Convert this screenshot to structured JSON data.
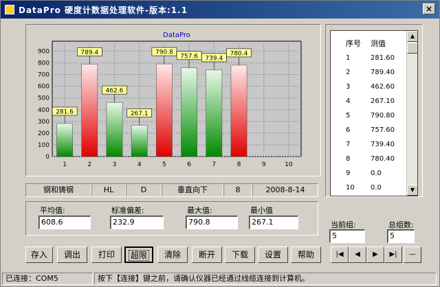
{
  "window": {
    "title": "DataPro 硬度计数据处理软件-版本:1.1",
    "close_label": "×"
  },
  "chart_data": {
    "type": "bar",
    "title": "DataPro",
    "categories": [
      "1",
      "2",
      "3",
      "4",
      "5",
      "6",
      "7",
      "8",
      "9",
      "10"
    ],
    "values": [
      281.6,
      789.4,
      462.6,
      267.1,
      790.8,
      757.6,
      739.4,
      780.4,
      null,
      null
    ],
    "value_labels": [
      "281.6",
      "789.4",
      "462.6",
      "267.1",
      "790.8",
      "757.6",
      "739.4",
      "780.4"
    ],
    "bar_colors": [
      "green",
      "red",
      "green",
      "green",
      "red",
      "green",
      "green",
      "red"
    ],
    "yticks": [
      "0",
      "100",
      "200",
      "300",
      "400",
      "500",
      "600",
      "700",
      "800",
      "900"
    ],
    "ylim": [
      0,
      950
    ],
    "grid": true
  },
  "list": {
    "headers": [
      "序号",
      "测值"
    ],
    "rows": [
      [
        "1",
        "281.60"
      ],
      [
        "2",
        "789.40"
      ],
      [
        "3",
        "462.60"
      ],
      [
        "4",
        "267.10"
      ],
      [
        "5",
        "790.80"
      ],
      [
        "6",
        "757.60"
      ],
      [
        "7",
        "739.40"
      ],
      [
        "8",
        "780.40"
      ],
      [
        "9",
        "0.0"
      ],
      [
        "10",
        "0.0"
      ]
    ]
  },
  "info": {
    "material": "钢和铸钢",
    "scale": "HL",
    "probe": "D",
    "direction": "垂直向下",
    "count": "8",
    "date": "2008-8-14"
  },
  "stats": {
    "avg_label": "平均值:",
    "avg_value": "608.6",
    "std_label": "标准偏差:",
    "std_value": "232.9",
    "max_label": "最大值:",
    "max_value": "790.8",
    "min_label": "最小值",
    "min_value": "267.1"
  },
  "group": {
    "current_label": "当前组:",
    "current_value": "5",
    "total_label": "总组数:",
    "total_value": "5"
  },
  "buttons": [
    "存入",
    "调出",
    "打印",
    "超限",
    "清除",
    "断开",
    "下载",
    "设置",
    "帮助"
  ],
  "nav": [
    "|◀",
    "◀",
    "▶",
    "▶|",
    "—"
  ],
  "status": {
    "connection": "已连接：COM5",
    "message": "按下【连接】键之前，请确认仪器已经通过线缆连接到计算机。"
  }
}
